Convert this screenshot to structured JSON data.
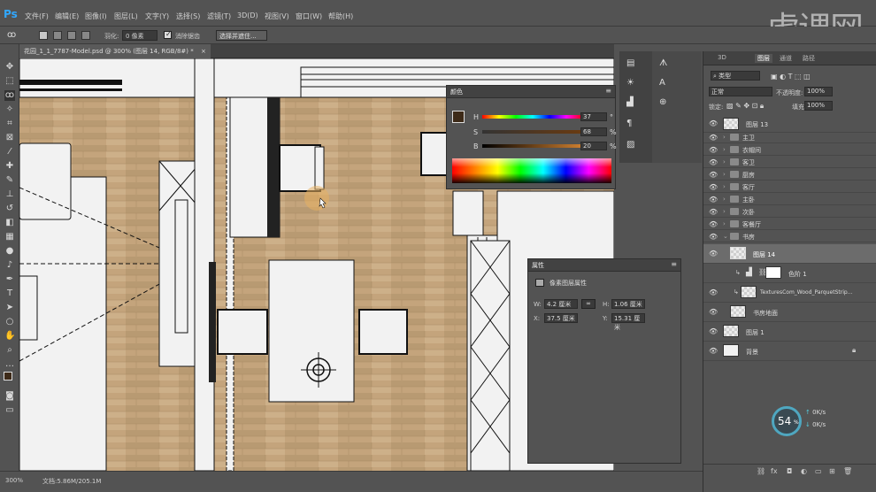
{
  "app": {
    "logo": "Ps"
  },
  "menu": [
    "文件(F)",
    "编辑(E)",
    "图像(I)",
    "图层(L)",
    "文字(Y)",
    "选择(S)",
    "滤镜(T)",
    "3D(D)",
    "视图(V)",
    "窗口(W)",
    "帮助(H)"
  ],
  "watermark": "虎课网",
  "options": {
    "feather_label": "羽化:",
    "feather_value": "0 像素",
    "antialias": "消除锯齿",
    "select_mask": "选择并遮住..."
  },
  "document": {
    "tab_title": "花园_1_1_7787-Model.psd @ 300% (图层 14, RGB/8#) *",
    "close": "×"
  },
  "status": {
    "zoom": "300%",
    "doc": "文档:5.86M/205.1M"
  },
  "color_panel": {
    "title": "颜色",
    "h_label": "H",
    "h_value": "37",
    "h_unit": "°",
    "s_label": "S",
    "s_value": "68",
    "s_unit": "%",
    "b_label": "B",
    "b_value": "20",
    "b_unit": "%",
    "fg": "#3d2a18",
    "bg": "#7a5a3a"
  },
  "properties_panel": {
    "title": "属性",
    "subtitle": "像素图层属性",
    "w_label": "W:",
    "w_value": "4.2 厘米",
    "h_label": "H:",
    "h_value": "1.06 厘米",
    "x_label": "X:",
    "x_value": "37.5 厘米",
    "y_label": "Y:",
    "y_value": "15.31 厘米"
  },
  "layers_panel": {
    "tabs": [
      "3D",
      "图层",
      "通道",
      "路径"
    ],
    "active_tab": "图层",
    "filter_label": "类型",
    "blend_mode": "正常",
    "opacity_label": "不透明度:",
    "opacity_value": "100%",
    "lock_label": "锁定:",
    "fill_label": "填充:",
    "fill_value": "100%",
    "layers": [
      {
        "name": "图层 13",
        "kind": "layer"
      },
      {
        "name": "主卫",
        "kind": "group"
      },
      {
        "name": "衣帽间",
        "kind": "group"
      },
      {
        "name": "客卫",
        "kind": "group"
      },
      {
        "name": "厨房",
        "kind": "group"
      },
      {
        "name": "客厅",
        "kind": "group"
      },
      {
        "name": "主卧",
        "kind": "group"
      },
      {
        "name": "次卧",
        "kind": "group"
      },
      {
        "name": "客餐厅",
        "kind": "group"
      },
      {
        "name": "书房",
        "kind": "group-open"
      },
      {
        "name": "图层 14",
        "kind": "layer-selected"
      },
      {
        "name": "色阶 1",
        "kind": "adjustment"
      },
      {
        "name": "TexturesCom_Wood_ParquetStrip...",
        "kind": "texture"
      },
      {
        "name": "书房地面",
        "kind": "layer"
      },
      {
        "name": "图层 1",
        "kind": "layer"
      },
      {
        "name": "背景",
        "kind": "background"
      }
    ]
  },
  "net_gauge": {
    "percent": "54",
    "unit": "%",
    "up": "0",
    "up_unit": "K/s",
    "down": "0",
    "down_unit": "K/s"
  }
}
